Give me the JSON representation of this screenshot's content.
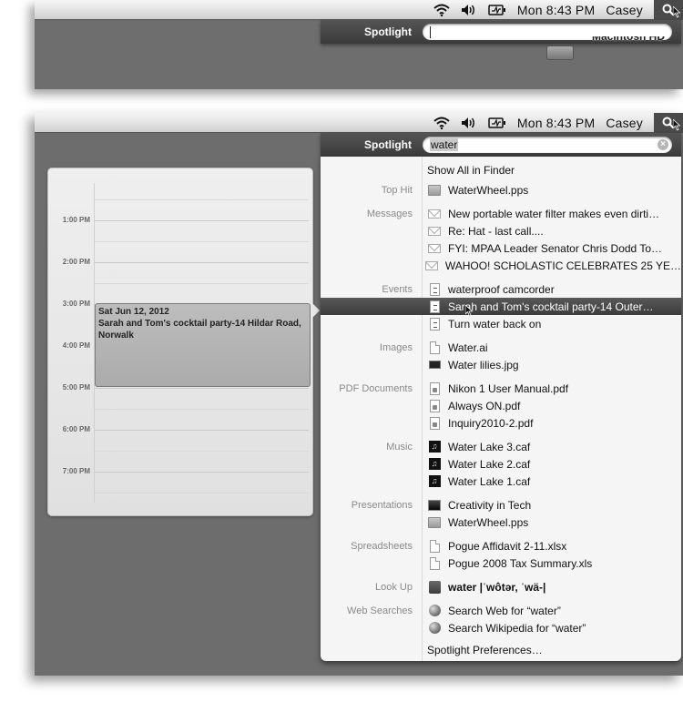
{
  "menubar": {
    "clock": "Mon 8:43 PM",
    "user": "Casey",
    "icons": [
      "wifi-icon",
      "volume-icon",
      "battery-icon",
      "spotlight-icon"
    ]
  },
  "top_panel": {
    "spotlight_label": "Spotlight",
    "search_value": "",
    "desktop_item_label": "Macintosh HD"
  },
  "bottom_panel": {
    "spotlight_label": "Spotlight",
    "search_value": "water",
    "clear_glyph": "×",
    "show_all": "Show All in Finder",
    "preferences": "Spotlight Preferences…",
    "groups": [
      {
        "category": "Top Hit",
        "items": [
          {
            "label": "WaterWheel.pps",
            "icon": "pps"
          }
        ]
      },
      {
        "category": "Messages",
        "items": [
          {
            "label": "New portable water filter makes even dirti…",
            "icon": "mail"
          },
          {
            "label": "Re: Hat - last call....",
            "icon": "mail"
          },
          {
            "label": "FYI: MPAA Leader Senator Chris Dodd To…",
            "icon": "mail"
          },
          {
            "label": "WAHOO! SCHOLASTIC CELEBRATES 25 YE…",
            "icon": "mail"
          }
        ]
      },
      {
        "category": "Events",
        "items": [
          {
            "label": "waterproof camcorder",
            "icon": "event"
          },
          {
            "label": "Sarah and Tom's cocktail party-14 Outer…",
            "icon": "event",
            "selected": true
          },
          {
            "label": "Turn water back on",
            "icon": "event"
          }
        ]
      },
      {
        "category": "Images",
        "items": [
          {
            "label": "Water.ai",
            "icon": "doc"
          },
          {
            "label": "Water lilies.jpg",
            "icon": "jpg"
          }
        ]
      },
      {
        "category": "PDF Documents",
        "items": [
          {
            "label": "Nikon 1 User Manual.pdf",
            "icon": "pdf"
          },
          {
            "label": "Always ON.pdf",
            "icon": "pdf"
          },
          {
            "label": "Inquiry2010-2.pdf",
            "icon": "pdf"
          }
        ]
      },
      {
        "category": "Music",
        "items": [
          {
            "label": "Water Lake 3.caf",
            "icon": "music"
          },
          {
            "label": "Water Lake 2.caf",
            "icon": "music"
          },
          {
            "label": "Water Lake 1.caf",
            "icon": "music"
          }
        ]
      },
      {
        "category": "Presentations",
        "items": [
          {
            "label": "Creativity in Tech",
            "icon": "pres"
          },
          {
            "label": "WaterWheel.pps",
            "icon": "pps"
          }
        ]
      },
      {
        "category": "Spreadsheets",
        "items": [
          {
            "label": "Pogue Affidavit 2-11.xlsx",
            "icon": "doc"
          },
          {
            "label": "Pogue 2008 Tax Summary.xls",
            "icon": "doc"
          }
        ]
      },
      {
        "category": "Look Up",
        "items": [
          {
            "label": "water |ˈwôtər, ˈwä-|",
            "icon": "dict",
            "bold": true
          }
        ]
      },
      {
        "category": "Web Searches",
        "items": [
          {
            "label": "Search Web for “water”",
            "icon": "globe"
          },
          {
            "label": "Search Wikipedia for “water”",
            "icon": "globe"
          }
        ]
      }
    ]
  },
  "calendar_preview": {
    "times": [
      "1:00 PM",
      "2:00 PM",
      "3:00 PM",
      "4:00 PM",
      "5:00 PM",
      "6:00 PM",
      "7:00 PM"
    ],
    "event": {
      "date": "Sat Jun 12, 2012",
      "title": "Sarah and Tom's cocktail party-14 Hildar Road, Norwalk"
    }
  }
}
